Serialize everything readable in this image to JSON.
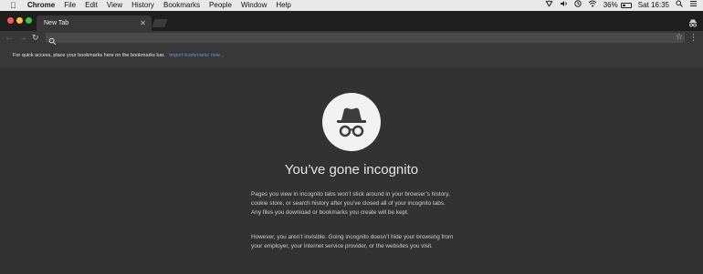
{
  "menubar": {
    "app_name": "Chrome",
    "items": [
      "File",
      "Edit",
      "View",
      "History",
      "Bookmarks",
      "People",
      "Window",
      "Help"
    ],
    "battery": "36%",
    "clock": "Sat 16:35"
  },
  "tabs": [
    {
      "label": "New Tab"
    }
  ],
  "bookmarks_bar": {
    "message": "For quick access, place your bookmarks here on the bookmarks bar.",
    "link": "Import bookmarks now..."
  },
  "page": {
    "title": "You’ve gone incognito",
    "paragraphs": [
      "Pages you view in incognito tabs won’t stick around in your browser’s history, cookie store, or search history after you’ve closed all of your incognito tabs. Any files you download or bookmarks you create will be kept.",
      "However, you aren’t invisible. Going incognito doesn’t hide your browsing from your employer, your internet service provider, or the websites you visit."
    ]
  },
  "colors": {
    "background": "#323232",
    "toolbar": "#383838",
    "link": "#5c93e4"
  }
}
